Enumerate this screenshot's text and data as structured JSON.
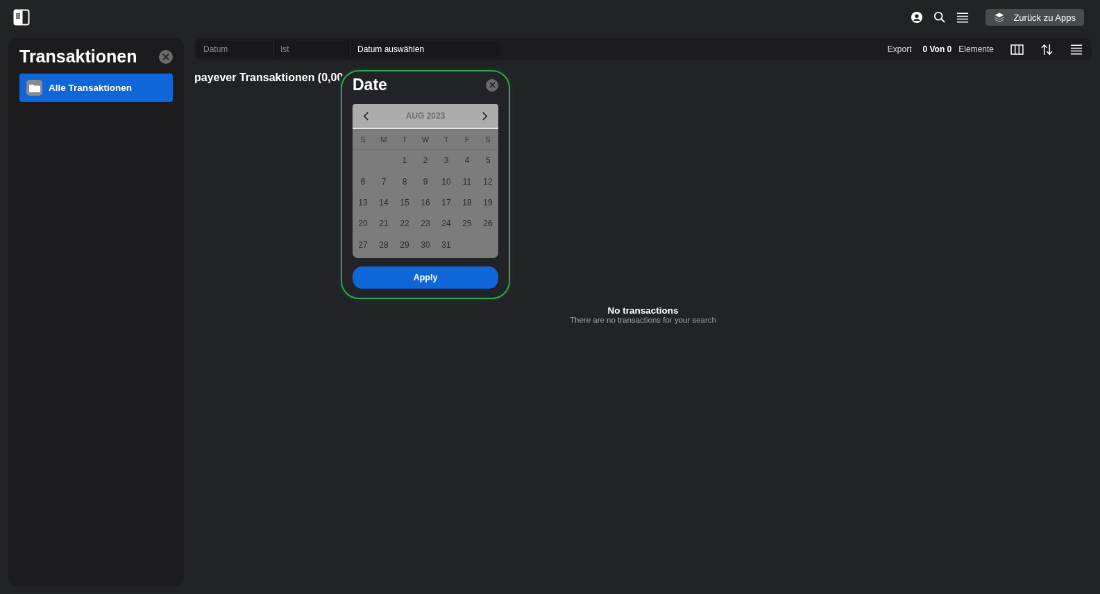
{
  "topbar": {
    "back_button": "Zurück zu Apps"
  },
  "sidebar": {
    "title": "Transaktionen",
    "items": [
      {
        "label": "Alle Transaktionen",
        "selected": true
      }
    ]
  },
  "filter_bar": {
    "field": "Datum",
    "operator": "Ist",
    "value": "Datum auswählen",
    "export": "Export",
    "count": "0 Von 0",
    "count_label": "Elemente"
  },
  "page_title": "payever Transaktionen (0,00",
  "date_dialog": {
    "title": "Date",
    "month": "AUG 2023",
    "weekdays": [
      "S",
      "M",
      "T",
      "W",
      "T",
      "F",
      "S"
    ],
    "weeks": [
      {
        "kind": "first",
        "days": [
          "1",
          "2",
          "3",
          "4",
          "5"
        ]
      },
      {
        "kind": "full",
        "days": [
          "6",
          "7",
          "8",
          "9",
          "10",
          "11",
          "12"
        ]
      },
      {
        "kind": "full",
        "days": [
          "13",
          "14",
          "15",
          "16",
          "17",
          "18",
          "19"
        ]
      },
      {
        "kind": "full",
        "days": [
          "20",
          "21",
          "22",
          "23",
          "24",
          "25",
          "26"
        ]
      },
      {
        "kind": "last",
        "days": [
          "27",
          "28",
          "29",
          "30",
          "31"
        ]
      }
    ],
    "apply": "Apply"
  },
  "empty_state": {
    "title": "No transactions",
    "message": "There are no transactions for your search"
  }
}
